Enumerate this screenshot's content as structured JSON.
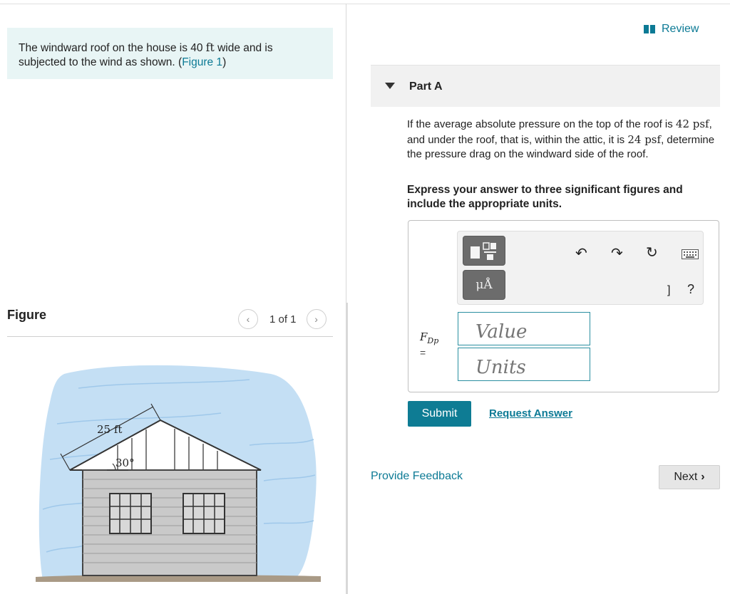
{
  "problem": {
    "text_before": "The windward roof on the house is 40 ",
    "unit_ft": "ft",
    "text_after": " wide and is subjected to the wind as shown. (",
    "figure_link": "Figure 1",
    "text_close": ")"
  },
  "figure_panel": {
    "title": "Figure",
    "pager": "1 of 1",
    "prev_icon": "chevron-left",
    "next_icon": "chevron-right",
    "labels": {
      "length": "25 ft",
      "angle": "30°"
    }
  },
  "review": {
    "label": "Review",
    "icon": "book-icon"
  },
  "part": {
    "title": "Part A",
    "question": {
      "t1": "If the average absolute pressure on the top of the roof is ",
      "p1": "42 psf",
      "t2": ", and under the roof, that is, within the attic, it is ",
      "p2": "24 psf",
      "t3": ", determine the pressure drag on the windward side of the roof."
    },
    "instruction": "Express your answer to three significant figures and include the appropriate units."
  },
  "answer": {
    "variable": "F",
    "variable_sub": "Dp",
    "equals": "=",
    "value_placeholder": "Value",
    "units_placeholder": "Units",
    "units_button": "μÅ",
    "toolbar_icons": [
      "templates-icon",
      "units-icon",
      "undo-icon",
      "redo-icon",
      "reset-icon",
      "keyboard-icon",
      "help-icon"
    ],
    "help": "?",
    "bracket": "]"
  },
  "actions": {
    "submit": "Submit",
    "request_answer": "Request Answer",
    "feedback": "Provide Feedback",
    "next": "Next"
  },
  "colors": {
    "accent": "#0e7c94",
    "problem_bg": "#e8f5f5",
    "wind": "#b9d9f2"
  }
}
